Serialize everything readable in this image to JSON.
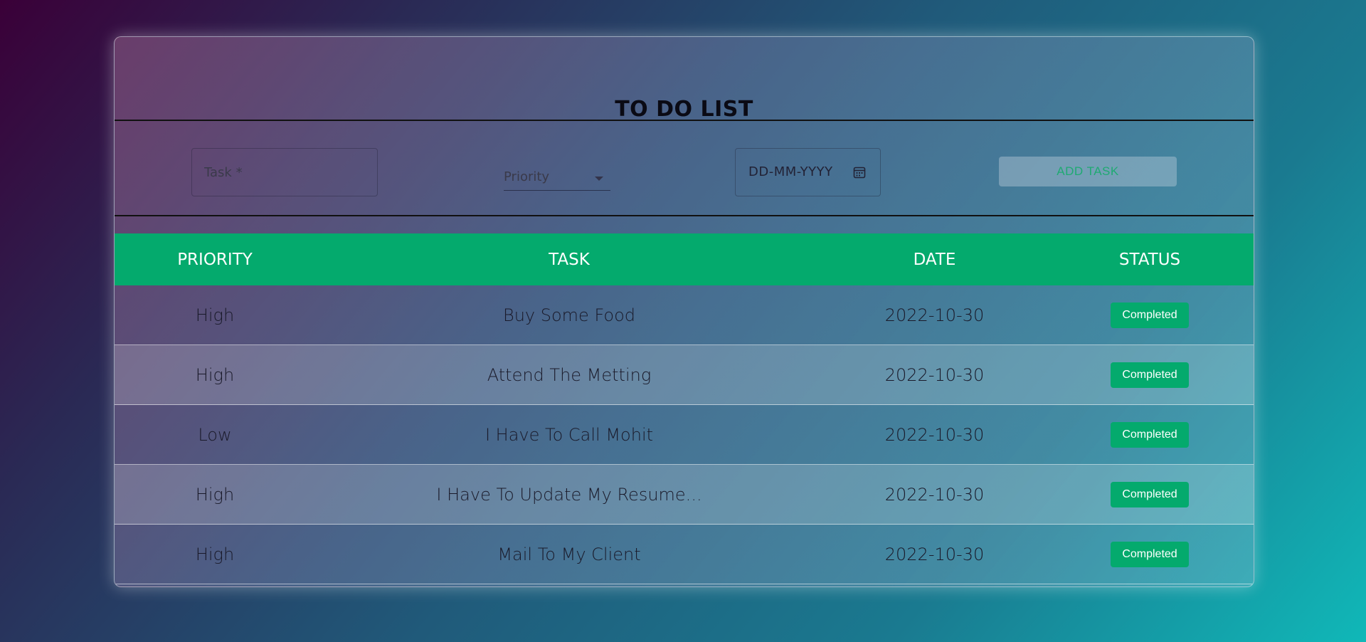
{
  "app": {
    "title": "TO DO LIST"
  },
  "form": {
    "task_placeholder": "Task *",
    "priority_label": "Priority",
    "date_placeholder": "DD-MM-YYYY",
    "add_button_label": "ADD TASK"
  },
  "table": {
    "headers": {
      "priority": "PRIORITY",
      "task": "TASK",
      "date": "DATE",
      "status": "STATUS"
    },
    "rows": [
      {
        "priority": "High",
        "task": "Buy Some Food",
        "date": "2022-10-30",
        "status": "Completed"
      },
      {
        "priority": "High",
        "task": "Attend The Metting",
        "date": "2022-10-30",
        "status": "Completed"
      },
      {
        "priority": "Low",
        "task": "I Have To Call Mohit",
        "date": "2022-10-30",
        "status": "Completed"
      },
      {
        "priority": "High",
        "task": "I Have To Update My Resume...",
        "date": "2022-10-30",
        "status": "Completed"
      },
      {
        "priority": "High",
        "task": "Mail To My Client",
        "date": "2022-10-30",
        "status": "Completed"
      }
    ]
  },
  "colors": {
    "accent": "#04aa6d",
    "header_text": "#ffffff",
    "body_text": "#1a1a2a"
  },
  "icons": {
    "date_picker": "calendar-icon",
    "dropdown": "chevron-down-icon"
  }
}
